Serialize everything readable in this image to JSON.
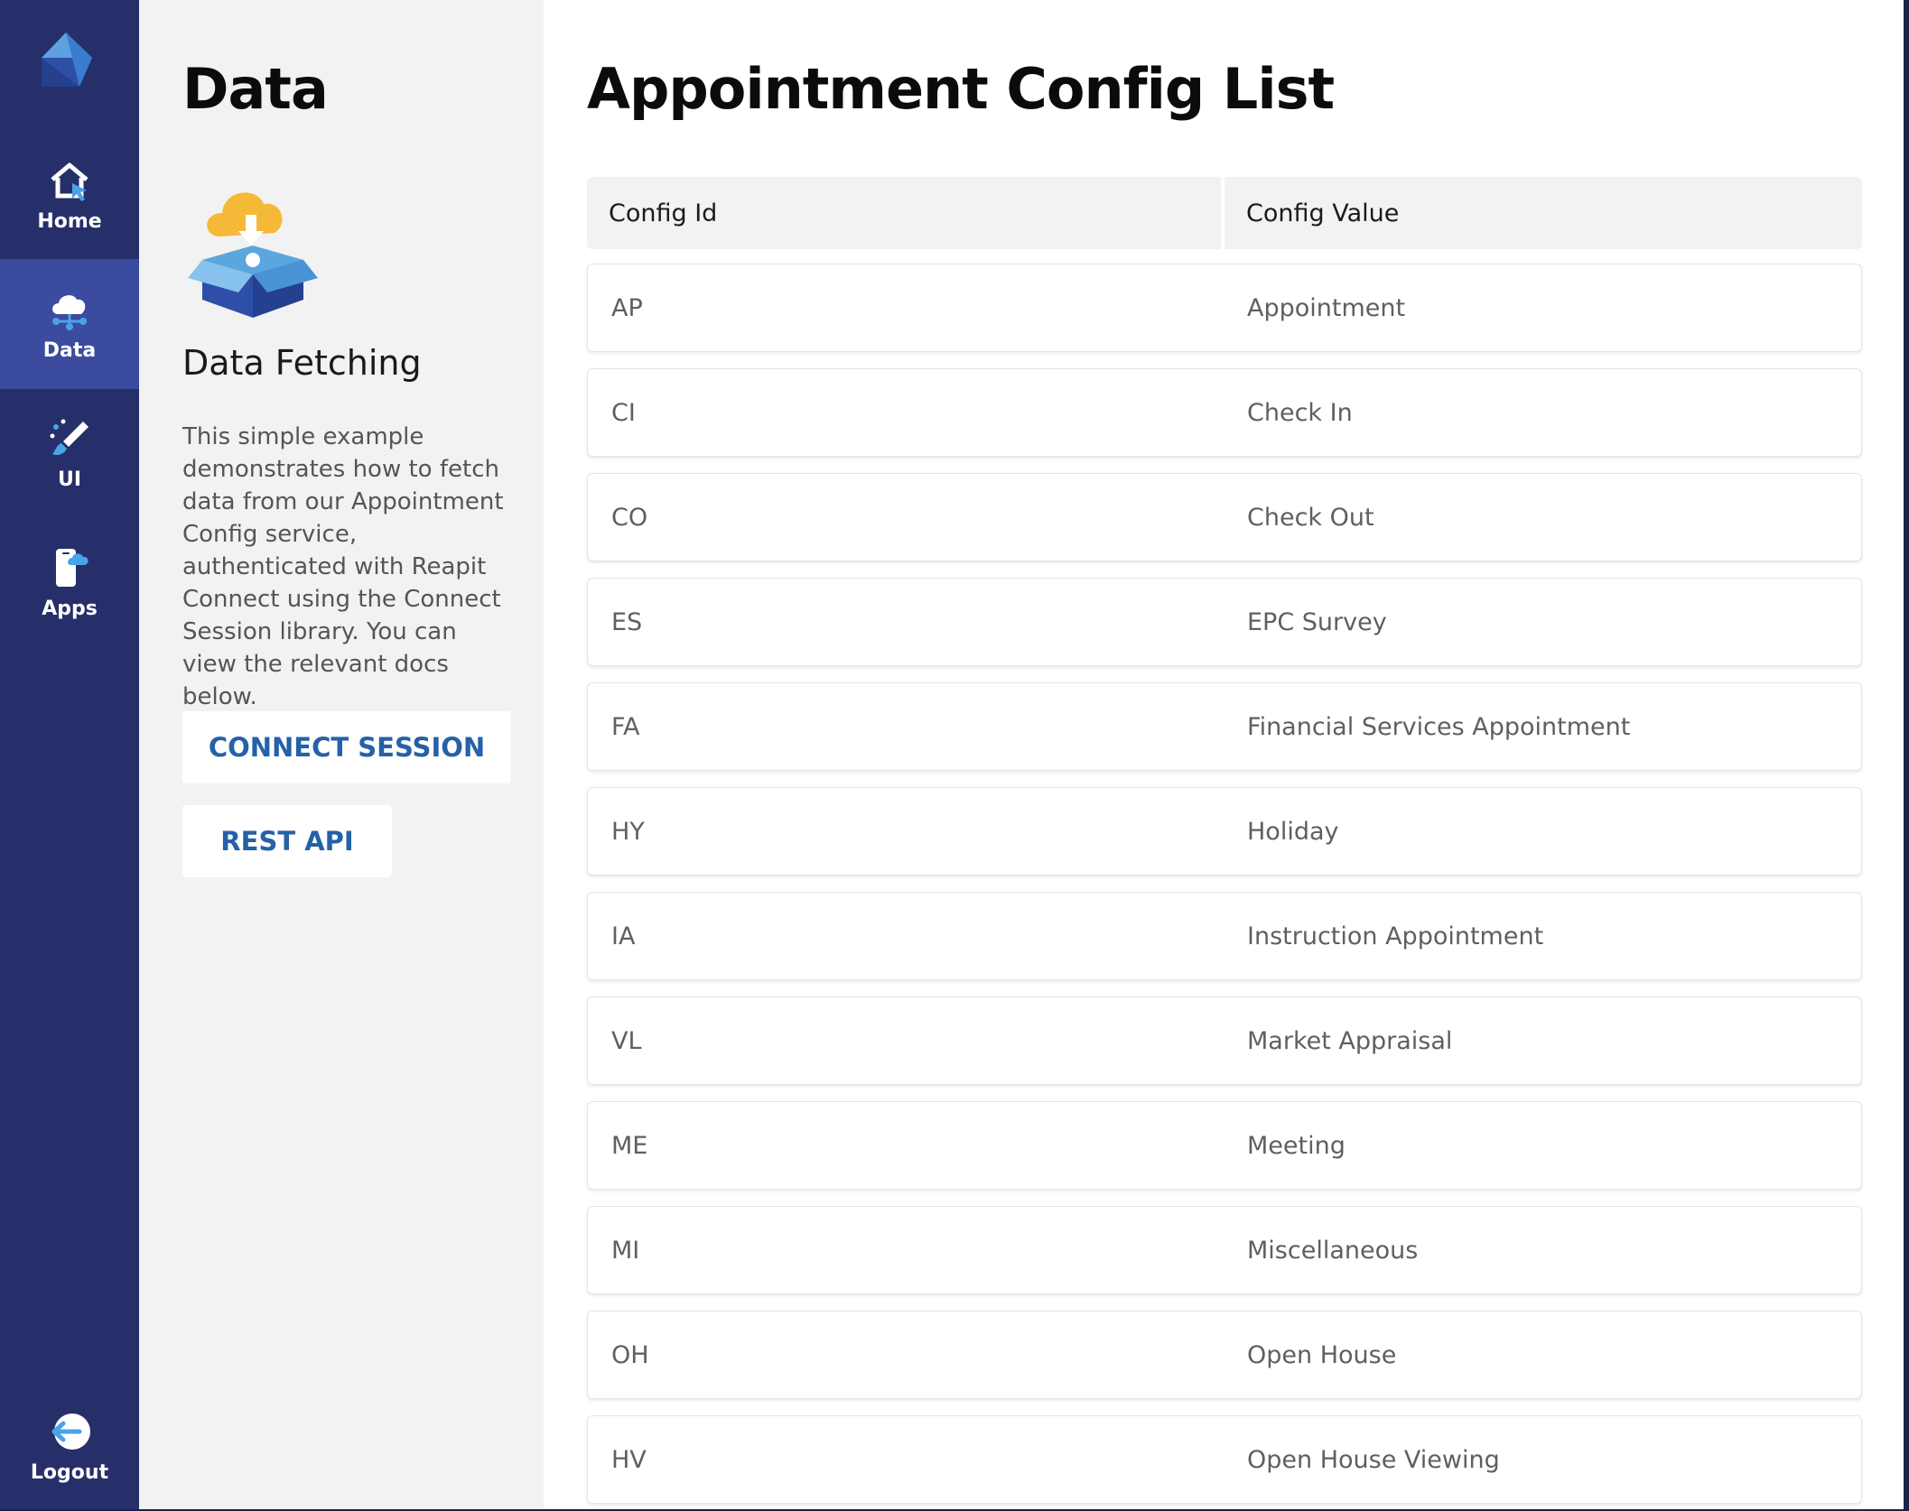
{
  "nav": {
    "items": [
      {
        "label": "Home",
        "icon": "home-icon"
      },
      {
        "label": "Data",
        "icon": "cloud-data-icon"
      },
      {
        "label": "UI",
        "icon": "brush-icon"
      },
      {
        "label": "Apps",
        "icon": "phone-cloud-icon"
      }
    ],
    "logout_label": "Logout",
    "active": "Data",
    "colors": {
      "background": "#262f69",
      "active": "#3b4ba0"
    }
  },
  "secondary": {
    "title": "Data",
    "subtitle": "Data Fetching",
    "description": "This simple example demonstrates how to fetch data from our Appointment Config service, authenticated with Reapit Connect using the Connect Session library. You can view the relevant docs below.",
    "buttons": {
      "connect_session": "CONNECT SESSION",
      "rest_api": "REST API"
    },
    "link_color": "#2461a8"
  },
  "main": {
    "title": "Appointment Config List",
    "columns": {
      "id": "Config Id",
      "value": "Config Value"
    },
    "rows": [
      {
        "id": "AP",
        "value": "Appointment"
      },
      {
        "id": "CI",
        "value": "Check In"
      },
      {
        "id": "CO",
        "value": "Check Out"
      },
      {
        "id": "ES",
        "value": "EPC Survey"
      },
      {
        "id": "FA",
        "value": "Financial Services Appointment"
      },
      {
        "id": "HY",
        "value": "Holiday"
      },
      {
        "id": "IA",
        "value": "Instruction Appointment"
      },
      {
        "id": "VL",
        "value": "Market Appraisal"
      },
      {
        "id": "ME",
        "value": "Meeting"
      },
      {
        "id": "MI",
        "value": "Miscellaneous"
      },
      {
        "id": "OH",
        "value": "Open House"
      },
      {
        "id": "HV",
        "value": "Open House Viewing"
      }
    ]
  }
}
